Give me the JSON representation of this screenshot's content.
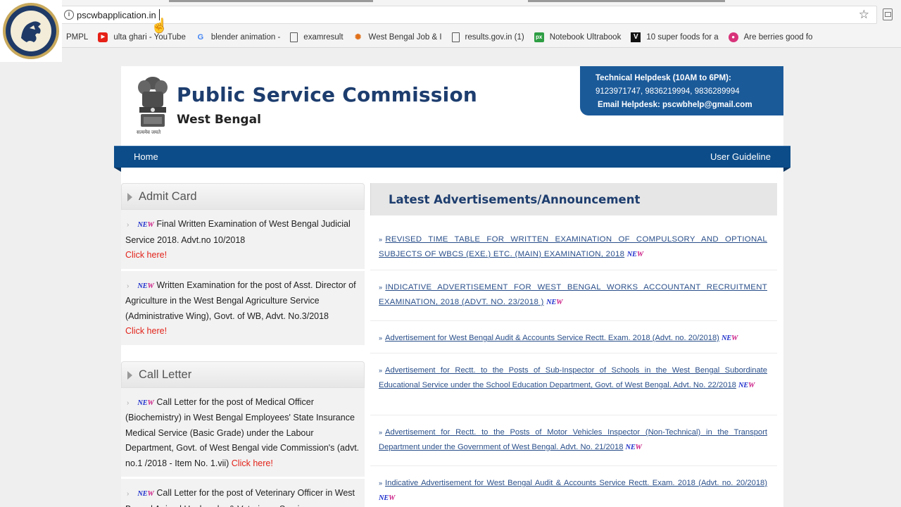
{
  "browser": {
    "url": "pscwbapplication.in",
    "bookmarks": [
      {
        "label": "PMPL",
        "icon": "none"
      },
      {
        "label": "ulta ghari - YouTube",
        "icon": "youtube-icon"
      },
      {
        "label": "blender animation -",
        "icon": "google-icon"
      },
      {
        "label": "examresult",
        "icon": "document-icon"
      },
      {
        "label": "West Bengal Job & I",
        "icon": "sun-icon"
      },
      {
        "label": "results.gov.in (1)",
        "icon": "page-icon"
      },
      {
        "label": "Notebook Ultrabook",
        "icon": "px-icon"
      },
      {
        "label": "10 super foods for a",
        "icon": "v-icon"
      },
      {
        "label": "Are berries good fo",
        "icon": "berry-icon"
      }
    ]
  },
  "header": {
    "title": "Public Service Commission",
    "subtitle": "West Bengal",
    "emblem_caption": "सत्यमेव जयते",
    "helpdesk": {
      "line1": "Technical Helpdesk (10AM to 6PM):",
      "line2": "9123971747, 9836219994, 9836289994",
      "line3": "Email Helpdesk: pscwbhelp@gmail.com"
    }
  },
  "nav": {
    "home": "Home",
    "guide": "User Guideline"
  },
  "badge": {
    "n": "NE",
    "w": "W"
  },
  "admit_card": {
    "title": "Admit Card",
    "items": [
      {
        "text": "Final Written Examination of West Bengal Judicial Service 2018. Advt.no 10/2018",
        "link": "Click here!"
      },
      {
        "text": "Written Examination for the post of Asst. Director of Agriculture in the West Bengal Agriculture Service (Administrative Wing), Govt. of WB, Advt. No.3/2018",
        "link": "Click here!"
      }
    ]
  },
  "call_letter": {
    "title": "Call Letter",
    "items": [
      {
        "text": "Call Letter for the post of Medical Officer (Biochemistry) in West Bengal Employees' State Insurance Medical Service (Basic Grade) under the Labour Department, Govt. of West Bengal vide Commission's (advt. no.1 /2018 - Item No. 1.vii)",
        "link": "Click here!"
      },
      {
        "text": "Call Letter for the post of Veterinary Officer in West Bengal Animal Husbandry & Veterinary Services",
        "link": ""
      }
    ]
  },
  "announcements": {
    "title": "Latest Advertisements/Announcement",
    "items": [
      "REVISED TIME TABLE FOR WRITTEN EXAMINATION OF COMPULSORY AND OPTIONAL SUBJECTS OF WBCS (EXE.) ETC. (MAIN) EXAMINATION, 2018",
      "INDICATIVE ADVERTISEMENT FOR WEST BENGAL WORKS ACCOUNTANT RECRUITMENT EXAMINATION, 2018 (ADVT. NO. 23/2018 )",
      "Advertisement for West Bengal Audit & Accounts Service Rectt. Exam. 2018 (Advt. no. 20/2018)",
      "Advertisement for Rectt. to the Posts of Sub-Inspector of Schools in the West Bengal Subordinate Educational Service under the School Education Department, Govt. of West Bengal. Advt. No. 22/2018",
      "Advertisement for Rectt. to the Posts of Motor Vehicles Inspector (Non-Technical) in the Transport Department under the Government of West Bengal. Advt. No. 21/2018",
      "Indicative Advertisement for West Bengal Audit & Accounts Service Rectt. Exam. 2018 (Advt. no. 20/2018)"
    ]
  },
  "colors": {
    "brand_blue": "#1d3d6e",
    "nav_blue": "#0c4c89",
    "helpdesk_blue": "#1b5a99",
    "link_red": "#e2231a",
    "link_blue": "#2a4f8a"
  }
}
